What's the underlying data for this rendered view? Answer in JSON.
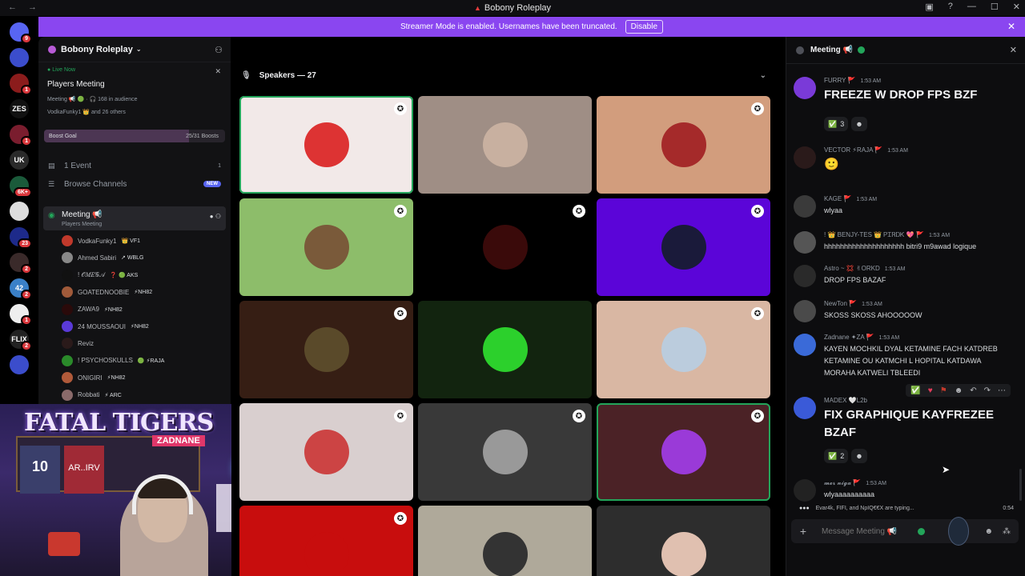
{
  "window": {
    "title": "Bobony Roleplay",
    "back": "←",
    "forward": "→",
    "controls": [
      "▣",
      "?",
      "—",
      "☐",
      "✕"
    ]
  },
  "banner": {
    "text": "Streamer Mode is enabled. Usernames have been truncated.",
    "disable_label": "Disable",
    "close": "✕"
  },
  "rail": {
    "servers": [
      {
        "label": "",
        "badge": "9",
        "color": "#5865f2"
      },
      {
        "label": "",
        "badge": "",
        "color": "#3b4dcc"
      },
      {
        "label": "",
        "badge": "1",
        "color": "#8b1c1c"
      },
      {
        "label": "ZES",
        "badge": "",
        "color": "#111"
      },
      {
        "label": "",
        "badge": "1",
        "color": "#7a1d2e"
      },
      {
        "label": "UK",
        "badge": "",
        "color": "#2a2a2a"
      },
      {
        "label": "",
        "badge": "6K+",
        "color": "#1a5a3a"
      },
      {
        "label": "",
        "badge": "",
        "color": "#ddd"
      },
      {
        "label": "",
        "badge": "23",
        "color": "#1d2a8a"
      },
      {
        "label": "",
        "badge": "2",
        "color": "#3a2a2a"
      },
      {
        "label": "42",
        "badge": "2",
        "color": "#3a80c8"
      },
      {
        "label": "",
        "badge": "1",
        "color": "#eee"
      },
      {
        "label": "FLIX",
        "badge": "2",
        "color": "#222"
      },
      {
        "label": "",
        "badge": "",
        "color": "#3b4dcc"
      }
    ]
  },
  "sidebar": {
    "server_name": "Bobony Roleplay",
    "live_label": "Live Now",
    "live_title": "Players Meeting",
    "live_meta": "Meeting 📢 🟢 · 🎧 168 in audience",
    "live_meta2": "VodkaFunky1 👑 and 26 others",
    "boost_goal_label": "Boost Goal",
    "boost_count": "25/31 Boosts",
    "boost_progress": 0.8,
    "events_label": "1 Event",
    "events_count": "1",
    "browse_label": "Browse Channels",
    "browse_badge": "NEW",
    "voice_channel": "Meeting 📢",
    "voice_status": "Players Meeting",
    "members": [
      {
        "name": "VodkaFunky1",
        "tag": "👑 VF1",
        "color": "#c0392b"
      },
      {
        "name": "Ahmed Sabiri",
        "tag": "↗ WBLG",
        "color": "#888"
      },
      {
        "name": "! 𝒪𝑀𝐸𝒢𝒜",
        "tag": "❓ 🟢 AKS",
        "color": "#111"
      },
      {
        "name": "GOATEDNOOBIE",
        "tag": "⚡NH82",
        "color": "#a05a3a"
      },
      {
        "name": "ZAWA9",
        "tag": "⚡NH82",
        "color": "#2a0a0a"
      },
      {
        "name": "24 MOUSSAOUI",
        "tag": "⚡NH82",
        "color": "#5a3ad8"
      },
      {
        "name": "Reviz",
        "tag": "",
        "color": "#2a1a1a"
      },
      {
        "name": "! PSYCHOSKULLS",
        "tag": "🟢 ⚡RAJA",
        "color": "#2a8a2a"
      },
      {
        "name": "ONIGIRI",
        "tag": "⚡NH82",
        "color": "#b05a3a"
      },
      {
        "name": "Robbati",
        "tag": "⚡ ARC",
        "color": "#8a6a6a"
      }
    ]
  },
  "cam": {
    "logo": "FATAL TIGERS",
    "name": "ZADNANE",
    "jersey": "10",
    "jersey2": "AR..IRV"
  },
  "stage": {
    "title": "Speakers — 27",
    "tiles": [
      {
        "bg": "#f2e9e8",
        "av": "#d33",
        "mod": true,
        "speaking": true
      },
      {
        "bg": "#9f8e85",
        "av": "#c8b0a0",
        "mod": false,
        "speaking": false
      },
      {
        "bg": "#d29d7d",
        "av": "#a52a2a",
        "mod": true,
        "speaking": false
      },
      {
        "bg": "#8dbd6a",
        "av": "#7a5a3a",
        "mod": true,
        "speaking": false
      },
      {
        "bg": "#000000",
        "av": "#3a0a0a",
        "mod": true,
        "speaking": false
      },
      {
        "bg": "#5b05d8",
        "av": "#1a1a3a",
        "mod": true,
        "speaking": false
      },
      {
        "bg": "#361e14",
        "av": "#5a4a2a",
        "mod": true,
        "speaking": false
      },
      {
        "bg": "#12240f",
        "av": "#2cd02c",
        "mod": false,
        "speaking": false
      },
      {
        "bg": "#d9b7a3",
        "av": "#bcd",
        "mod": true,
        "speaking": false
      },
      {
        "bg": "#d9cfcf",
        "av": "#c44",
        "mod": true,
        "speaking": false
      },
      {
        "bg": "#393939",
        "av": "#999",
        "mod": true,
        "speaking": false
      },
      {
        "bg": "#4b2226",
        "av": "#9a3ad8",
        "mod": true,
        "speaking": true
      },
      {
        "bg": "#c80d0d",
        "av": "#c80d0d",
        "mod": true,
        "speaking": false
      },
      {
        "bg": "#afa99a",
        "av": "#333",
        "mod": false,
        "speaking": false
      },
      {
        "bg": "#2d2d2d",
        "av": "#e0c0b0",
        "mod": false,
        "speaking": false
      }
    ]
  },
  "chat": {
    "channel": "Meeting 📢",
    "messages": [
      {
        "user": "FURRY 🚩",
        "time": "1:53 AM",
        "text": "FREEZE W DROP FPS BZF",
        "big": true,
        "av": "#7a3ad8"
      },
      {
        "user": "VECTOR ⚡RAJA 🚩",
        "time": "1:53 AM",
        "text": "🙂",
        "big": true,
        "av": "#2a1a1a"
      },
      {
        "user": "KAGE 🚩",
        "time": "1:53 AM",
        "text": "wlyaa",
        "big": false,
        "av": "#3a3a3a"
      },
      {
        "user": "! 👑 BENJY-TES 👑 ᏢᏆᏒᎠᏦ 💖 🚩",
        "time": "1:53 AM",
        "text": "hhhhhhhhhhhhhhhhhhhh bitri9 m9awad logique",
        "big": false,
        "av": "#555"
      },
      {
        "user": "Astro ~ 💢 ✌ORKD",
        "time": "1:53 AM",
        "text": "DROP FPS BAZAF",
        "big": false,
        "av": "#2a2a2a"
      },
      {
        "user": "NewTon 🚩",
        "time": "1:53 AM",
        "text": "SKOSS SKOSS AHOOOOOW",
        "big": false,
        "av": "#4a4a4a"
      },
      {
        "user": "Zadnane ✦ZA 🚩",
        "time": "1:53 AM",
        "text": "KAYEN MOCHKIL DYAL KETAMINE FACH KATDREB KETAMINE OU KATMCHI L HOPITAL KATDAWA MORAHA KATWELI TBLEEDI",
        "big": false,
        "av": "#3a6ad8"
      },
      {
        "user": "MADEX 🤍L2b",
        "time": "",
        "text": "FIX GRAPHIQUE KAYFREZEE BZAF",
        "big": true,
        "av": "#3a5ad8"
      },
      {
        "user": "𝓶𝓮𝓻 𝓷𝓲𝓰𝓪 🚩",
        "time": "1:53 AM",
        "text": "wlyaaaaaaaaaa",
        "big": false,
        "av": "#222"
      }
    ],
    "reaction_a": {
      "emoji": "✅",
      "count": "3"
    },
    "reaction_b": {
      "emoji": "✅",
      "count": "2"
    },
    "add_reaction": "☻",
    "typing": "Evar4k, FIFI, and ΝρΙQ€€X are typing...",
    "typing_time": "0:54",
    "compose_placeholder": "Message Meeting 📢",
    "compose_plus": "+"
  }
}
